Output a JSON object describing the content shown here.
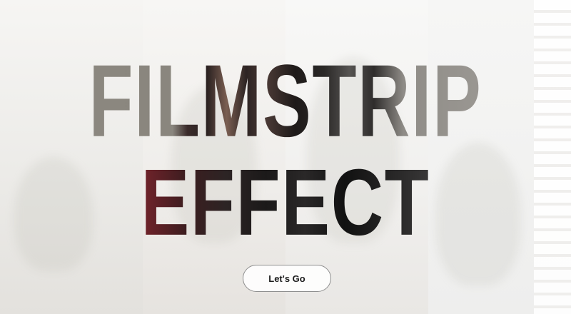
{
  "hero": {
    "title_line_1": "FILMSTRIP",
    "title_line_2": "EFFECT"
  },
  "cta": {
    "label": "Let's Go"
  },
  "colors": {
    "background": "#f4f3f1",
    "button_border": "#8f8f8f",
    "button_text": "#1c1c1c"
  }
}
